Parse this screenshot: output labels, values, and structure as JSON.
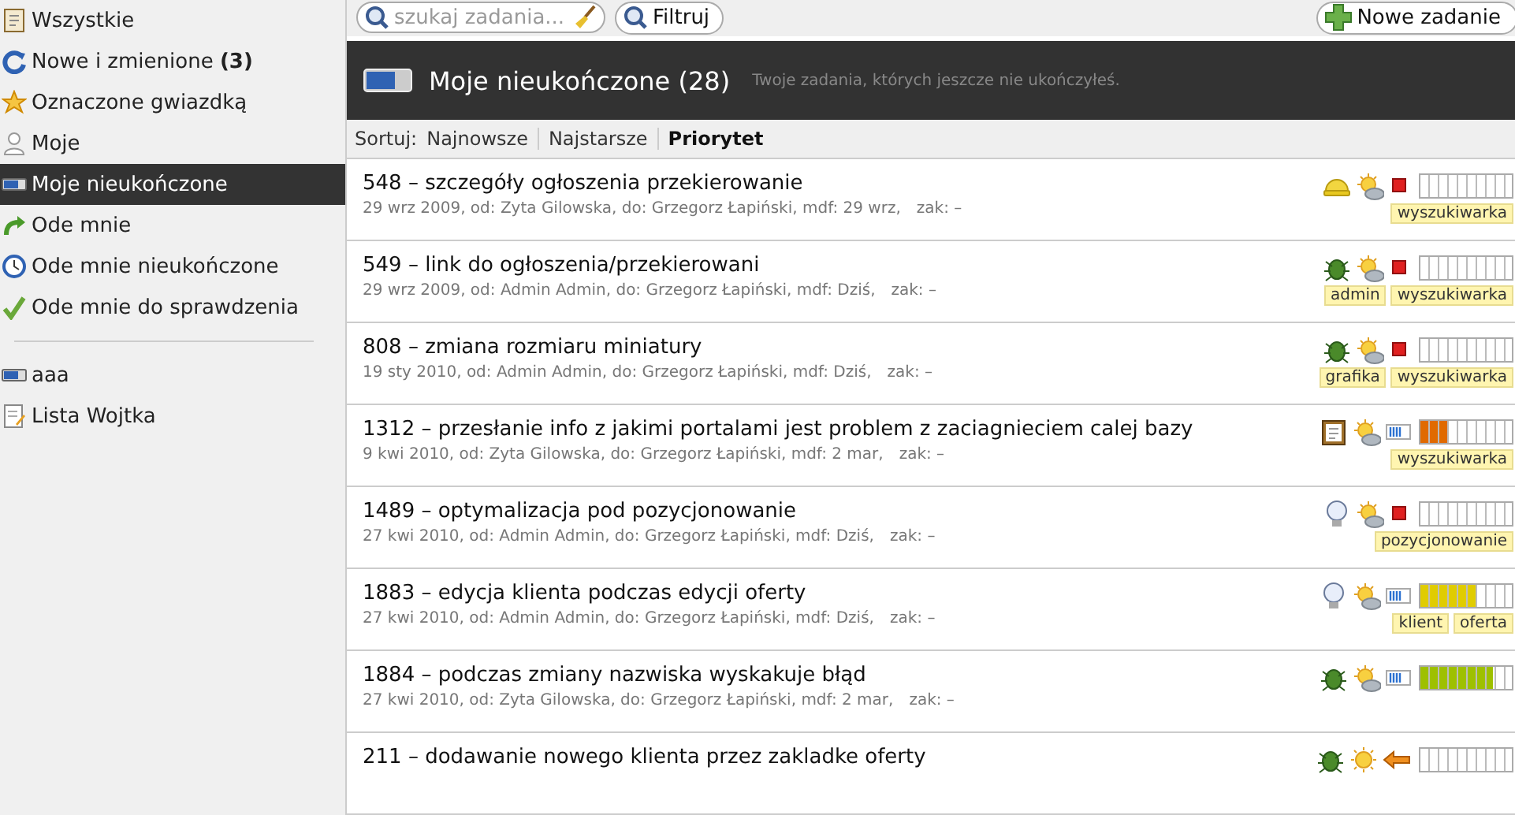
{
  "sidebar": {
    "items": [
      {
        "label": "Wszystkie",
        "kind": "document",
        "selected": false
      },
      {
        "label": "Nowe i zmienione **(3)**",
        "kind": "refresh",
        "selected": false
      },
      {
        "label": "Oznaczone gwiazdką",
        "kind": "star",
        "selected": false
      },
      {
        "label": "Moje",
        "kind": "person",
        "selected": false
      },
      {
        "label": "Moje nieukończone",
        "kind": "battery",
        "selected": true
      },
      {
        "label": "Ode mnie",
        "kind": "redo",
        "selected": false
      },
      {
        "label": "Ode mnie nieukończone",
        "kind": "clock",
        "selected": false
      },
      {
        "label": "Ode mnie do sprawdzenia",
        "kind": "check",
        "selected": false
      }
    ],
    "lists": [
      {
        "label": "aaa",
        "kind": "battery",
        "selected": false
      },
      {
        "label": "Lista Wojtka",
        "kind": "note",
        "selected": false
      }
    ]
  },
  "toolbar": {
    "search": {
      "placeholder": "szukaj zadania..."
    },
    "filter_button": "Filtruj",
    "new_button": "Nowe zadanie"
  },
  "header": {
    "title": "Moje nieukończone (28)",
    "subtitle": "Twoje zadania, których jeszcze nie ukończyłeś."
  },
  "sort": {
    "label": "Sortuj:",
    "options": [
      {
        "label": "Najnowsze",
        "selected": false
      },
      {
        "label": "Najstarsze",
        "selected": false
      },
      {
        "label": "Priorytet",
        "selected": true
      }
    ]
  },
  "tasks": [
    {
      "title": "548 – szczegóły ogłoszenia przekierowanie",
      "meta": "29 wrz 2009, od: Zyta Gilowska, do: Grzegorz Łapiński, mdf: 29 wrz,",
      "closed": "zak: –",
      "icons": [
        {
          "kind": "helmet"
        },
        {
          "kind": "sun-cloud"
        },
        {
          "kind": "square"
        }
      ],
      "level": 0,
      "tags": [
        "wyszukiwarka"
      ]
    },
    {
      "title": "549 – link do ogłoszenia/przekierowani",
      "meta": "29 wrz 2009, od: Admin Admin, do: Grzegorz Łapiński, mdf: Dziś,",
      "closed": "zak: –",
      "icons": [
        {
          "kind": "bug"
        },
        {
          "kind": "sun-cloud"
        },
        {
          "kind": "square"
        }
      ],
      "level": 0,
      "tags": [
        "admin",
        "wyszukiwarka"
      ]
    },
    {
      "title": "808 – zmiana rozmiaru miniatury",
      "meta": "19 sty 2010, od: Admin Admin, do: Grzegorz Łapiński, mdf: Dziś,",
      "closed": "zak: –",
      "icons": [
        {
          "kind": "bug"
        },
        {
          "kind": "sun-cloud"
        },
        {
          "kind": "square"
        }
      ],
      "level": 0,
      "tags": [
        "grafika",
        "wyszukiwarka"
      ]
    },
    {
      "title": "1312 – przesłanie info z jakimi portalami jest problem z zaciagnieciem calej bazy",
      "meta": "9 kwi 2010, od: Zyta Gilowska, do: Grzegorz Łapiński, mdf: 2 mar,",
      "closed": "zak: –",
      "icons": [
        {
          "kind": "clipboard"
        },
        {
          "kind": "sun-cloud"
        },
        {
          "kind": "bars"
        }
      ],
      "level": 0.3,
      "tags": [
        "wyszukiwarka"
      ]
    },
    {
      "title": "1489 – optymalizacja pod pozycjonowanie",
      "meta": "27 kwi 2010, od: Admin Admin, do: Grzegorz Łapiński, mdf: Dziś,",
      "closed": "zak: –",
      "icons": [
        {
          "kind": "bulb"
        },
        {
          "kind": "sun-cloud"
        },
        {
          "kind": "square"
        }
      ],
      "level": 0,
      "tags": [
        "pozycjonowanie"
      ]
    },
    {
      "title": "1883 – edycja klienta podczas edycji oferty",
      "meta": "27 kwi 2010, od: Admin Admin, do: Grzegorz Łapiński, mdf: Dziś,",
      "closed": "zak: –",
      "icons": [
        {
          "kind": "bulb"
        },
        {
          "kind": "sun-cloud"
        },
        {
          "kind": "bars"
        }
      ],
      "level": 0.6,
      "tags": [
        "klient",
        "oferta"
      ]
    },
    {
      "title": "1884 – podczas zmiany nazwiska wyskakuje błąd",
      "meta": "27 kwi 2010, od: Zyta Gilowska, do: Grzegorz Łapiński, mdf: 2 mar,",
      "closed": "zak: –",
      "icons": [
        {
          "kind": "bug"
        },
        {
          "kind": "sun-cloud"
        },
        {
          "kind": "bars"
        }
      ],
      "level": 0.8
    },
    {
      "title": "211 – dodawanie nowego klienta przez zakladke oferty",
      "icons": [
        {
          "kind": "bug"
        },
        {
          "kind": "sun"
        },
        {
          "kind": "arrow"
        }
      ],
      "level": 0
    }
  ]
}
